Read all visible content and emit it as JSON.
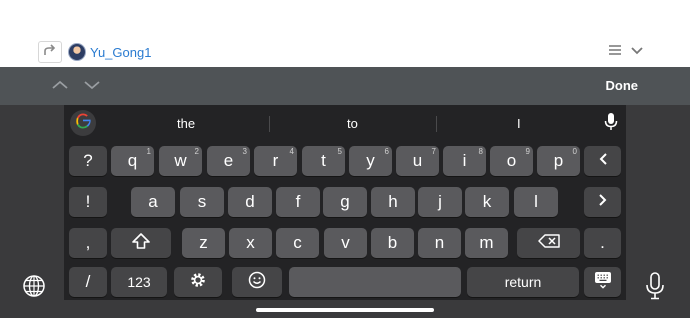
{
  "post": {
    "username": "Yu_Gong1"
  },
  "accessory": {
    "done_label": "Done"
  },
  "suggestions": [
    "the",
    "to",
    "I"
  ],
  "keyboard": {
    "row1": [
      {
        "main": "q",
        "hint": "1"
      },
      {
        "main": "w",
        "hint": "2"
      },
      {
        "main": "e",
        "hint": "3"
      },
      {
        "main": "r",
        "hint": "4"
      },
      {
        "main": "t",
        "hint": "5"
      },
      {
        "main": "y",
        "hint": "6"
      },
      {
        "main": "u",
        "hint": "7"
      },
      {
        "main": "i",
        "hint": "8"
      },
      {
        "main": "o",
        "hint": "9"
      },
      {
        "main": "p",
        "hint": "0"
      }
    ],
    "row1_left": "?",
    "row2": [
      "a",
      "s",
      "d",
      "f",
      "g",
      "h",
      "j",
      "k",
      "l"
    ],
    "row2_left": "!",
    "row3": [
      "z",
      "x",
      "c",
      "v",
      "b",
      "n",
      "m"
    ],
    "row3_left": ",",
    "row3_right": ".",
    "row4_left": "/",
    "numbers_label": "123",
    "return_label": "return"
  },
  "colors": {
    "accent_link": "#2a7bd0",
    "keyboard_bg": "#232325",
    "key_bg": "#5a5a5d"
  }
}
